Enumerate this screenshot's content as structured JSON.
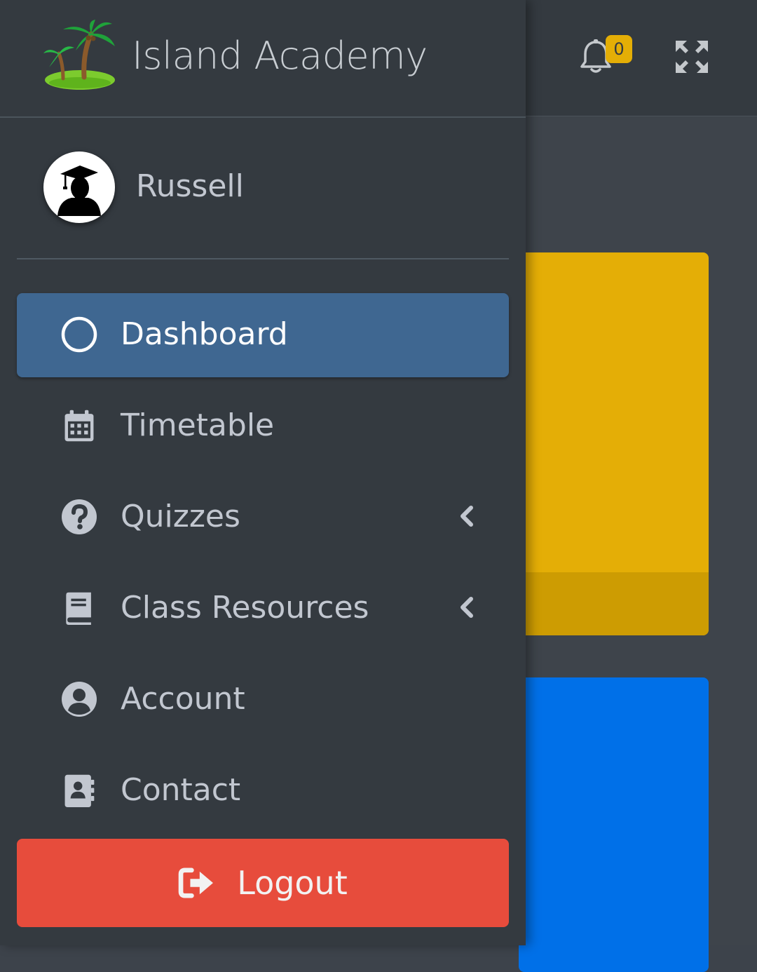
{
  "brand": {
    "title": "Island Academy"
  },
  "header": {
    "notification_count": "0"
  },
  "user": {
    "name": "Russell"
  },
  "nav": {
    "items": [
      {
        "label": "Dashboard",
        "icon": "circle-outline-icon",
        "active": true
      },
      {
        "label": "Timetable",
        "icon": "calendar-icon"
      },
      {
        "label": "Quizzes",
        "icon": "question-circle-icon",
        "has_submenu": true
      },
      {
        "label": "Class Resources",
        "icon": "book-icon",
        "has_submenu": true
      },
      {
        "label": "Account",
        "icon": "user-circle-icon"
      },
      {
        "label": "Contact",
        "icon": "address-book-icon"
      }
    ]
  },
  "logout": {
    "label": "Logout"
  },
  "colors": {
    "sidebar_bg": "#343a40",
    "active_item": "#3f6791",
    "logout_bg": "#e74c3c",
    "badge": "#e4ae06",
    "card_yellow": "#e4ae06",
    "card_blue": "#0070e8"
  }
}
